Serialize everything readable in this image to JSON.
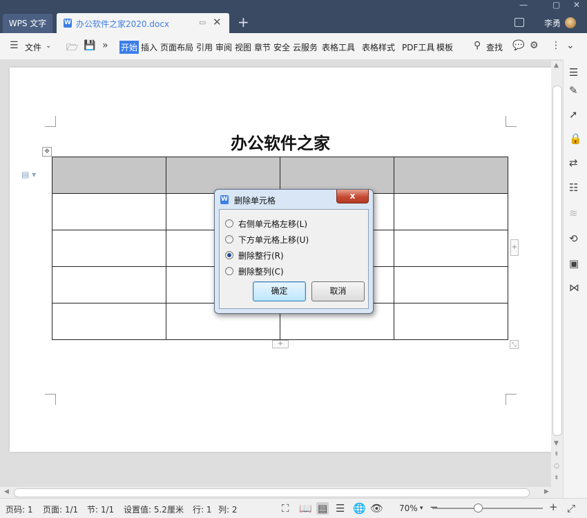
{
  "titlebar": {
    "app_tab": "WPS 文字",
    "doc_tab": "办公软件之家2020.docx",
    "new_tab": "+",
    "user": "李勇"
  },
  "ribbon": {
    "file_menu": "文件",
    "tabs": [
      "开始",
      "插入",
      "页面布局",
      "引用",
      "审阅",
      "视图",
      "章节",
      "安全",
      "云服务",
      "表格工具",
      "表格样式",
      "PDF工具",
      "模板"
    ],
    "active_tab": "开始",
    "search": "查找"
  },
  "document": {
    "title": "办公软件之家",
    "table": {
      "rows": 5,
      "cols": 4
    }
  },
  "dialog": {
    "title": "删除单元格",
    "close": "x",
    "options": [
      {
        "label": "右侧单元格左移(L)",
        "checked": false
      },
      {
        "label": "下方单元格上移(U)",
        "checked": false
      },
      {
        "label": "删除整行(R)",
        "checked": true
      },
      {
        "label": "删除整列(C)",
        "checked": false
      }
    ],
    "ok": "确定",
    "cancel": "取消"
  },
  "status": {
    "page_num": "页码: 1",
    "pages": "页面: 1/1",
    "section": "节: 1/1",
    "setting": "设置值: 5.2厘米",
    "row": "行: 1",
    "col": "列: 2",
    "zoom": "70%"
  },
  "colors": {
    "accent": "#3c7ee6",
    "titlebar": "#3a4a63",
    "header_cell": "#c6c6c6"
  }
}
